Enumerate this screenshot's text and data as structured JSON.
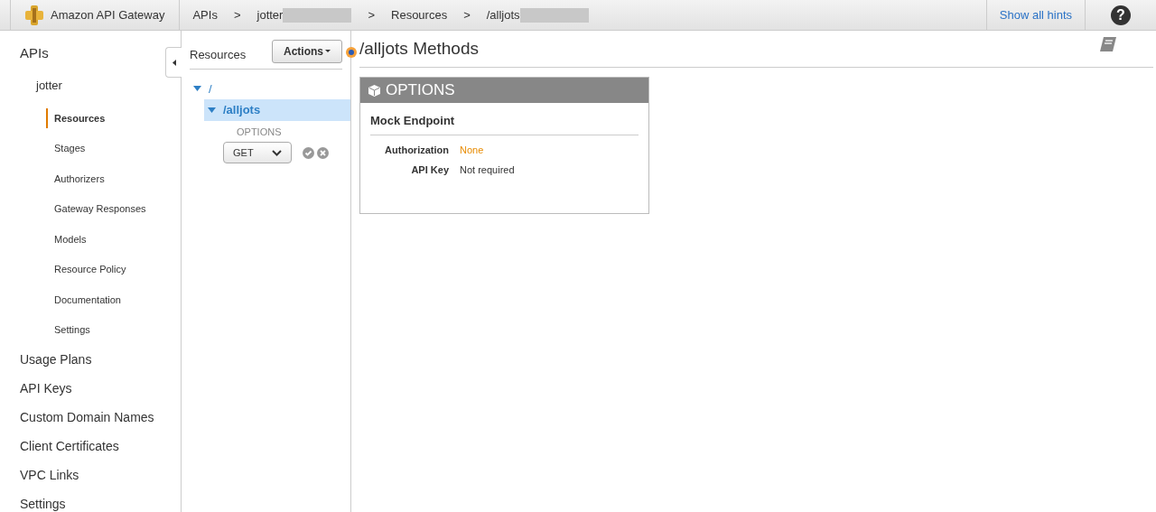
{
  "header": {
    "product": "Amazon API Gateway",
    "breadcrumbs": [
      {
        "label": "APIs",
        "redacted": false
      },
      {
        "label": "jotter",
        "redacted": true
      },
      {
        "label": "Resources",
        "redacted": false
      },
      {
        "label": "/alljots",
        "redacted": true
      }
    ],
    "separator": ">",
    "hints": "Show all hints",
    "help": "?"
  },
  "sidebar": {
    "title": "APIs",
    "api": "jotter",
    "items": [
      {
        "label": "Resources",
        "selected": true
      },
      {
        "label": "Stages",
        "selected": false
      },
      {
        "label": "Authorizers",
        "selected": false
      },
      {
        "label": "Gateway Responses",
        "selected": false
      },
      {
        "label": "Models",
        "selected": false
      },
      {
        "label": "Resource Policy",
        "selected": false
      },
      {
        "label": "Documentation",
        "selected": false
      },
      {
        "label": "Settings",
        "selected": false
      }
    ],
    "links": [
      "Usage Plans",
      "API Keys",
      "Custom Domain Names",
      "Client Certificates",
      "VPC Links",
      "Settings"
    ]
  },
  "resources": {
    "title": "Resources",
    "actions": "Actions",
    "tree": [
      {
        "path": "/",
        "expanded": true,
        "selected": false,
        "children": [
          {
            "path": "/alljots",
            "expanded": true,
            "selected": true,
            "methods": [
              "OPTIONS"
            ],
            "new_method": "GET"
          }
        ]
      }
    ]
  },
  "main": {
    "title": "/alljots Methods",
    "method": {
      "name": "OPTIONS",
      "integration": "Mock Endpoint",
      "properties": [
        {
          "label": "Authorization",
          "value": "None",
          "kind": "link"
        },
        {
          "label": "API Key",
          "value": "Not required",
          "kind": "text"
        }
      ]
    }
  }
}
